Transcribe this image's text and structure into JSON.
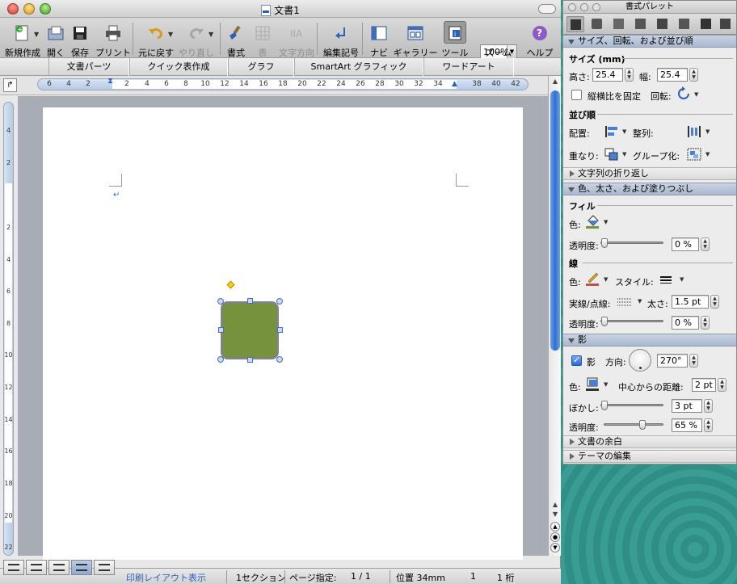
{
  "window": {
    "title": "文書1"
  },
  "toolbar": {
    "new_label": "新規作成",
    "open_label": "開く",
    "save_label": "保存",
    "print_label": "プリント",
    "undo_label": "元に戻す",
    "redo_label": "やり直し",
    "format_label": "書式",
    "table_label": "表",
    "textdir_label": "文字方向",
    "editmark_label": "編集記号",
    "navi_label": "ナビ",
    "gallery_label": "ギャラリー",
    "tools_label": "ツール",
    "zoom_label": "ズーム",
    "zoom_value": "100%",
    "help_label": "ヘルプ"
  },
  "ribbon": {
    "tabs": [
      "文書パーツ",
      "クイック表作成",
      "グラフ",
      "SmartArt グラフィック",
      "ワードアート"
    ]
  },
  "ruler": {
    "h_numbers": [
      "6",
      "4",
      "2",
      "2",
      "4",
      "6",
      "8",
      "10",
      "12",
      "14",
      "16",
      "18",
      "20",
      "22",
      "24",
      "26",
      "28",
      "30",
      "32",
      "34",
      "38",
      "40",
      "42"
    ],
    "v_numbers": [
      "4",
      "2",
      "2",
      "4",
      "6",
      "8",
      "10",
      "12",
      "14",
      "16",
      "18",
      "20",
      "22",
      "24"
    ]
  },
  "document": {
    "paragraph_mark": "↵",
    "shape_fill": "#76923C"
  },
  "status": {
    "view": "印刷レイアウト表示",
    "section": "1セクション",
    "page_label": "ページ指定:",
    "page_value": "1 / 1",
    "position": "位置 34mm",
    "line": "1",
    "column": "1 桁"
  },
  "palette": {
    "title": "書式パレット",
    "size_section": "サイズ、回転、および並び順",
    "size_head": "サイズ (mm)",
    "height_label": "高さ:",
    "height_value": "25.4",
    "width_label": "幅:",
    "width_value": "25.4",
    "lock_label": "縦横比を固定",
    "rotate_label": "回転:",
    "order_head": "並び順",
    "align_label": "配置:",
    "distribute_label": "整列:",
    "overlap_label": "重なり:",
    "group_label": "グループ化:",
    "wrap_section": "文字列の折り返し",
    "color_section": "色、太さ、および塗りつぶし",
    "fill_head": "フィル",
    "fill_color_label": "色:",
    "fill_trans_label": "透明度:",
    "fill_trans_value": "0 %",
    "fill_trans_level": 0,
    "line_head": "線",
    "line_color_label": "色:",
    "style_label": "スタイル:",
    "dash_label": "実線/点線:",
    "weight_label": "太さ:",
    "weight_value": "1.5 pt",
    "line_trans_label": "透明度:",
    "line_trans_value": "0 %",
    "line_trans_level": 0,
    "shadow_section": "影",
    "shadow_check_label": "影",
    "direction_label": "方向:",
    "direction_value": "270°",
    "shadow_color_label": "色:",
    "distance_label": "中心からの距離:",
    "distance_value": "2 pt",
    "blur_label": "ぼかし:",
    "blur_value": "3 pt",
    "shadow_trans_label": "透明度:",
    "shadow_trans_value": "65 %",
    "shadow_trans_level": 0.65,
    "margins_section": "文書の余白",
    "theme_section": "テーマの編集"
  }
}
